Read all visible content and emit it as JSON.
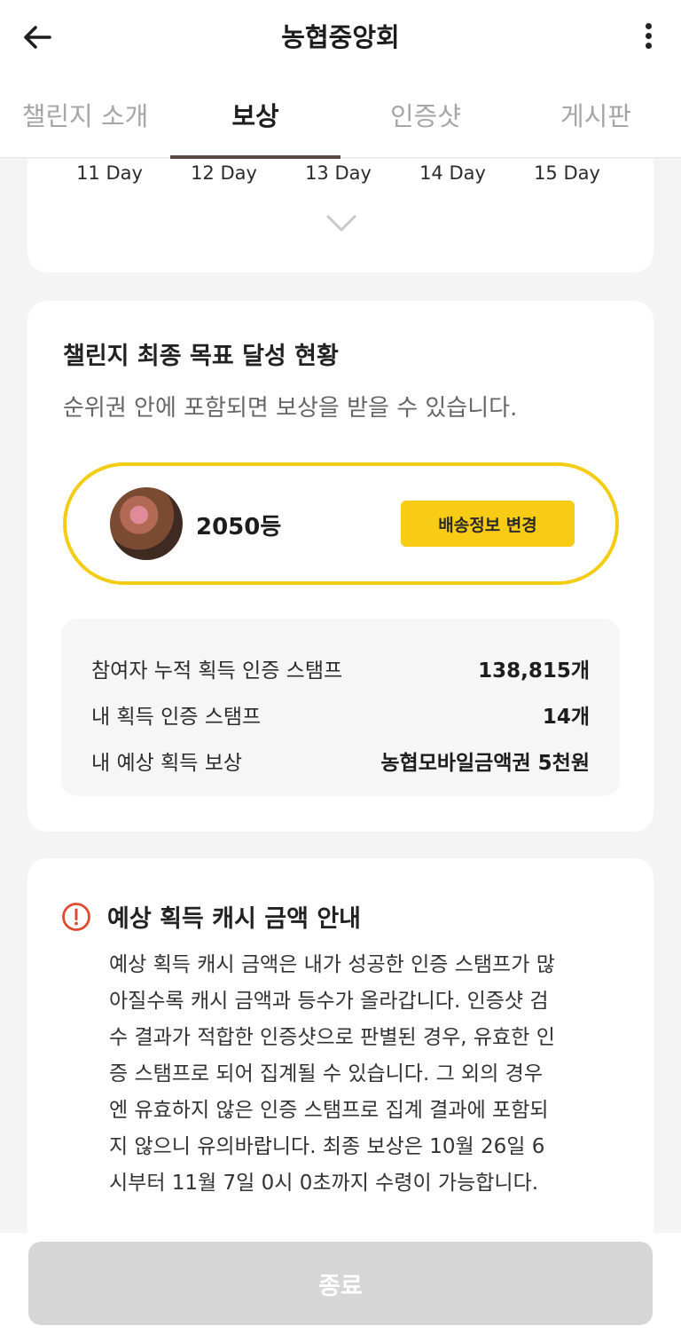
{
  "appbar": {
    "title": "농협중앙회",
    "back_icon": "arrow-left-icon",
    "more_icon": "more-vertical-icon"
  },
  "tabs": [
    {
      "label": "챌린지 소개",
      "active": false
    },
    {
      "label": "보상",
      "active": true
    },
    {
      "label": "인증샷",
      "active": false
    },
    {
      "label": "게시판",
      "active": false
    }
  ],
  "days": [
    "11 Day",
    "12 Day",
    "13 Day",
    "14 Day",
    "15 Day"
  ],
  "goal": {
    "title": "챌린지 최종 목표 달성 현황",
    "subtitle": "순위권 안에 포함되면 보상을 받을 수 있습니다.",
    "rank": "2050등",
    "shipping_button": "배송정보 변경",
    "stats": [
      {
        "label": "참여자 누적 획득 인증 스탬프",
        "value": "138,815개"
      },
      {
        "label": "내 획득 인증 스탬프",
        "value": "14개"
      },
      {
        "label": "내 예상 획득 보상",
        "value": "농협모바일금액권 5천원"
      }
    ]
  },
  "info": {
    "title": "예상 획득 캐시 금액 안내",
    "lines": [
      "예상 획득 캐시 금액은 내가 성공한 인증 스탬프가 많",
      "아질수록 캐시 금액과 등수가 올라갑니다. 인증샷 검",
      "수 결과가 적합한 인증샷으로 판별된 경우, 유효한 인",
      "증 스탬프로 되어 집계될 수 있습니다. 그 외의 경우",
      "엔 유효하지 않은 인증 스탬프로 집계 결과에 포함되",
      "지 않으니 유의바랍니다. 최종 보상은 10월 26일 6",
      "시부터 11월 7일 0시 0초까지 수령이 가능합니다."
    ]
  },
  "bottom": {
    "end_button": "종료"
  },
  "colors": {
    "accent": "#f8cb14",
    "tab_indicator": "#5a4b47",
    "warning": "#e04a2f",
    "disabled": "#d6d6d6"
  }
}
